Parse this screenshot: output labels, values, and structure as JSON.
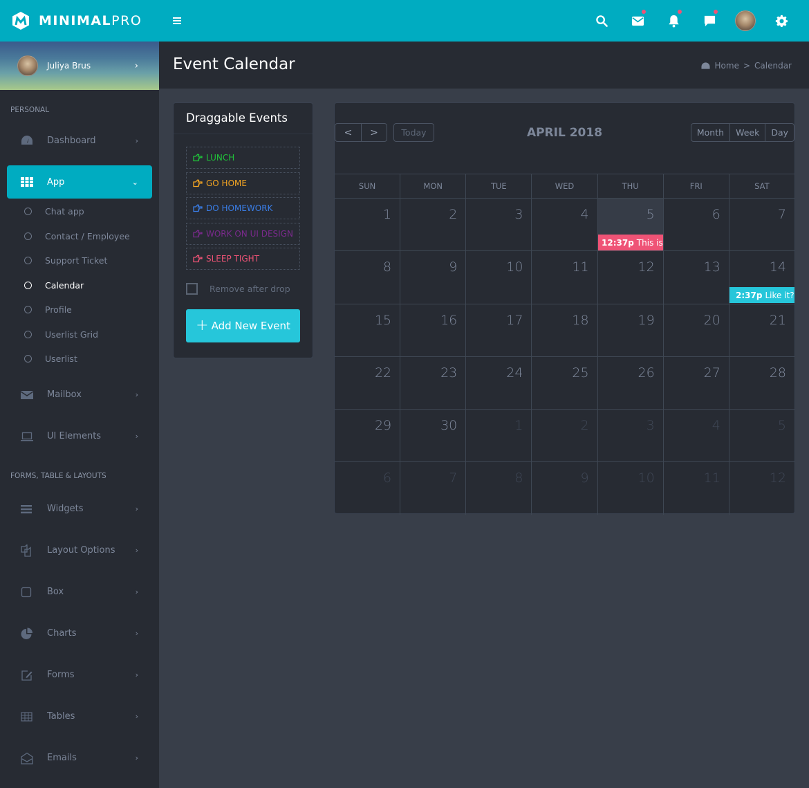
{
  "brand": {
    "name_bold": "MINIMAL",
    "name_light": "PRO"
  },
  "topbar": {
    "icons": [
      "search-icon",
      "mail-icon",
      "bell-icon",
      "chat-icon",
      "user-avatar",
      "gear-icon"
    ],
    "notification_dots": [
      "mail",
      "bell",
      "chat"
    ]
  },
  "user": {
    "name": "Juliya Brus"
  },
  "sidebar": {
    "sections": [
      {
        "header": "PERSONAL"
      },
      {
        "header": "FORMS, TABLE & LAYOUTS"
      }
    ],
    "personal_items": [
      {
        "label": "Dashboard",
        "icon": "dashboard-icon"
      },
      {
        "label": "App",
        "icon": "apps-grid-icon",
        "active": true
      }
    ],
    "app_submenu": [
      {
        "label": "Chat app"
      },
      {
        "label": "Contact / Employee"
      },
      {
        "label": "Support Ticket"
      },
      {
        "label": "Calendar",
        "current": true
      },
      {
        "label": "Profile"
      },
      {
        "label": "Userlist Grid"
      },
      {
        "label": "Userlist"
      }
    ],
    "personal_items_after": [
      {
        "label": "Mailbox",
        "icon": "envelope-icon"
      },
      {
        "label": "UI Elements",
        "icon": "laptop-icon"
      }
    ],
    "forms_items": [
      {
        "label": "Widgets",
        "icon": "bars-icon"
      },
      {
        "label": "Layout Options",
        "icon": "copy-icon"
      },
      {
        "label": "Box",
        "icon": "square-icon"
      },
      {
        "label": "Charts",
        "icon": "pie-chart-icon"
      },
      {
        "label": "Forms",
        "icon": "edit-icon"
      },
      {
        "label": "Tables",
        "icon": "table-icon"
      },
      {
        "label": "Emails",
        "icon": "envelope-open-icon"
      }
    ]
  },
  "page": {
    "title": "Event Calendar",
    "breadcrumb": {
      "home": "Home",
      "separator": ">",
      "current": "Calendar"
    }
  },
  "draggable": {
    "title": "Draggable Events",
    "events": [
      {
        "label": "LUNCH",
        "color": "#20c33a"
      },
      {
        "label": "GO HOME",
        "color": "#f5a623"
      },
      {
        "label": "DO HOMEWORK",
        "color": "#3a7ee8"
      },
      {
        "label": "WORK ON UI DESIGN",
        "color": "#7a2a8c"
      },
      {
        "label": "SLEEP TIGHT",
        "color": "#ef5376"
      }
    ],
    "remove_after_drop": {
      "label": "Remove after drop",
      "checked": false
    },
    "add_button": "Add New Event"
  },
  "calendar": {
    "title": "APRIL 2018",
    "today_label": "Today",
    "prev_label": "<",
    "next_label": ">",
    "views": [
      "Month",
      "Week",
      "Day"
    ],
    "weekdays": [
      "SUN",
      "MON",
      "TUE",
      "WED",
      "THU",
      "FRI",
      "SAT"
    ],
    "weeks": [
      [
        {
          "d": "1"
        },
        {
          "d": "2"
        },
        {
          "d": "3"
        },
        {
          "d": "4"
        },
        {
          "d": "5",
          "today": true
        },
        {
          "d": "6"
        },
        {
          "d": "7"
        }
      ],
      [
        {
          "d": "8"
        },
        {
          "d": "9"
        },
        {
          "d": "10"
        },
        {
          "d": "11"
        },
        {
          "d": "12"
        },
        {
          "d": "13"
        },
        {
          "d": "14"
        }
      ],
      [
        {
          "d": "15"
        },
        {
          "d": "16"
        },
        {
          "d": "17"
        },
        {
          "d": "18"
        },
        {
          "d": "19"
        },
        {
          "d": "20"
        },
        {
          "d": "21"
        }
      ],
      [
        {
          "d": "22"
        },
        {
          "d": "23"
        },
        {
          "d": "24"
        },
        {
          "d": "25"
        },
        {
          "d": "26"
        },
        {
          "d": "27"
        },
        {
          "d": "28"
        }
      ],
      [
        {
          "d": "29"
        },
        {
          "d": "30"
        },
        {
          "d": "1",
          "other": true
        },
        {
          "d": "2",
          "other": true
        },
        {
          "d": "3",
          "other": true
        },
        {
          "d": "4",
          "other": true
        },
        {
          "d": "5",
          "other": true
        }
      ],
      [
        {
          "d": "6",
          "other": true
        },
        {
          "d": "7",
          "other": true
        },
        {
          "d": "8",
          "other": true
        },
        {
          "d": "9",
          "other": true
        },
        {
          "d": "10",
          "other": true
        },
        {
          "d": "11",
          "other": true
        },
        {
          "d": "12",
          "other": true
        }
      ]
    ],
    "events": [
      {
        "time": "12:37p",
        "title": "This is t",
        "week": 0,
        "day": 4,
        "color": "#ef5376"
      },
      {
        "time": "2:37p",
        "title": "Like it?",
        "week": 1,
        "day": 6,
        "color": "#26c6da"
      }
    ]
  }
}
